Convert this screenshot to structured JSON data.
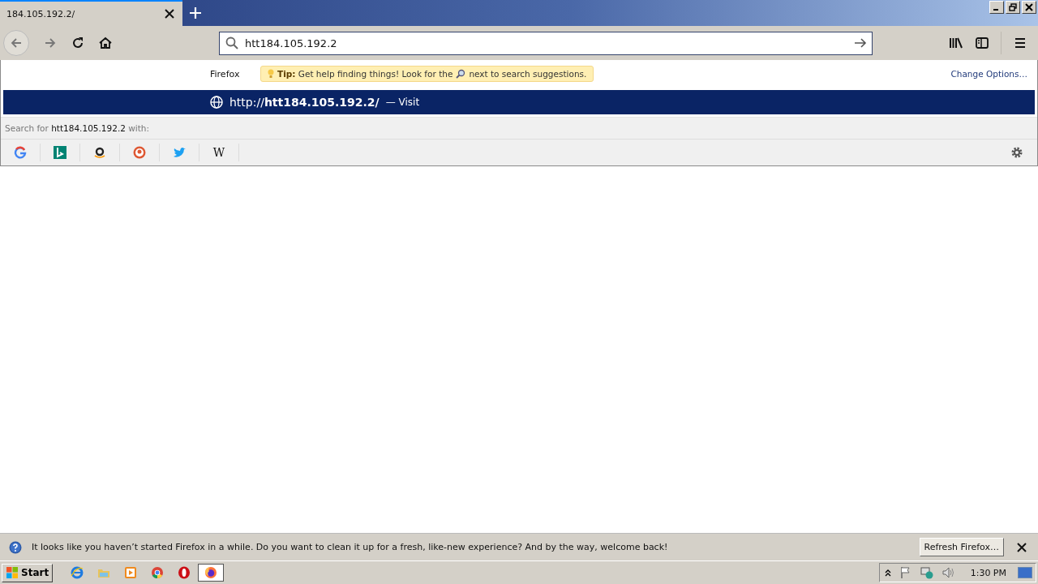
{
  "tab": {
    "title": "184.105.192.2/",
    "selected": true
  },
  "url_bar": {
    "value": "htt184.105.192.2"
  },
  "dropdown": {
    "engine_label": "Firefox",
    "tip": "**Tip:** Get help finding things! Look for the",
    "tip_end": "next to search suggestions.",
    "change_options": "Change Options…",
    "result": {
      "url": "http://**htt184.105.192.2/**",
      "action": "— Visit",
      "selected": true
    },
    "search_for": "Search for **htt184.105.192.2** with:",
    "engines": [
      {
        "kind": "google"
      },
      {
        "kind": "bing"
      },
      {
        "kind": "amazon"
      },
      {
        "kind": "duckduckgo"
      },
      {
        "kind": "twitter"
      },
      {
        "kind": "wikipedia",
        "label": "W"
      }
    ]
  },
  "notification": {
    "message": "It looks like you haven’t started Firefox in a while. Do you want to clean it up for a fresh, like-new experience? And by the way, welcome back!",
    "button": "Refresh Firefox…"
  },
  "taskbar": {
    "start": "Start",
    "apps": [
      {
        "kind": "ie",
        "selected": false
      },
      {
        "kind": "folder",
        "selected": false
      },
      {
        "kind": "media",
        "selected": false
      },
      {
        "kind": "chrome",
        "selected": false
      },
      {
        "kind": "opera",
        "selected": false
      },
      {
        "kind": "firefox",
        "selected": true
      }
    ],
    "clock": "1:30 PM"
  }
}
